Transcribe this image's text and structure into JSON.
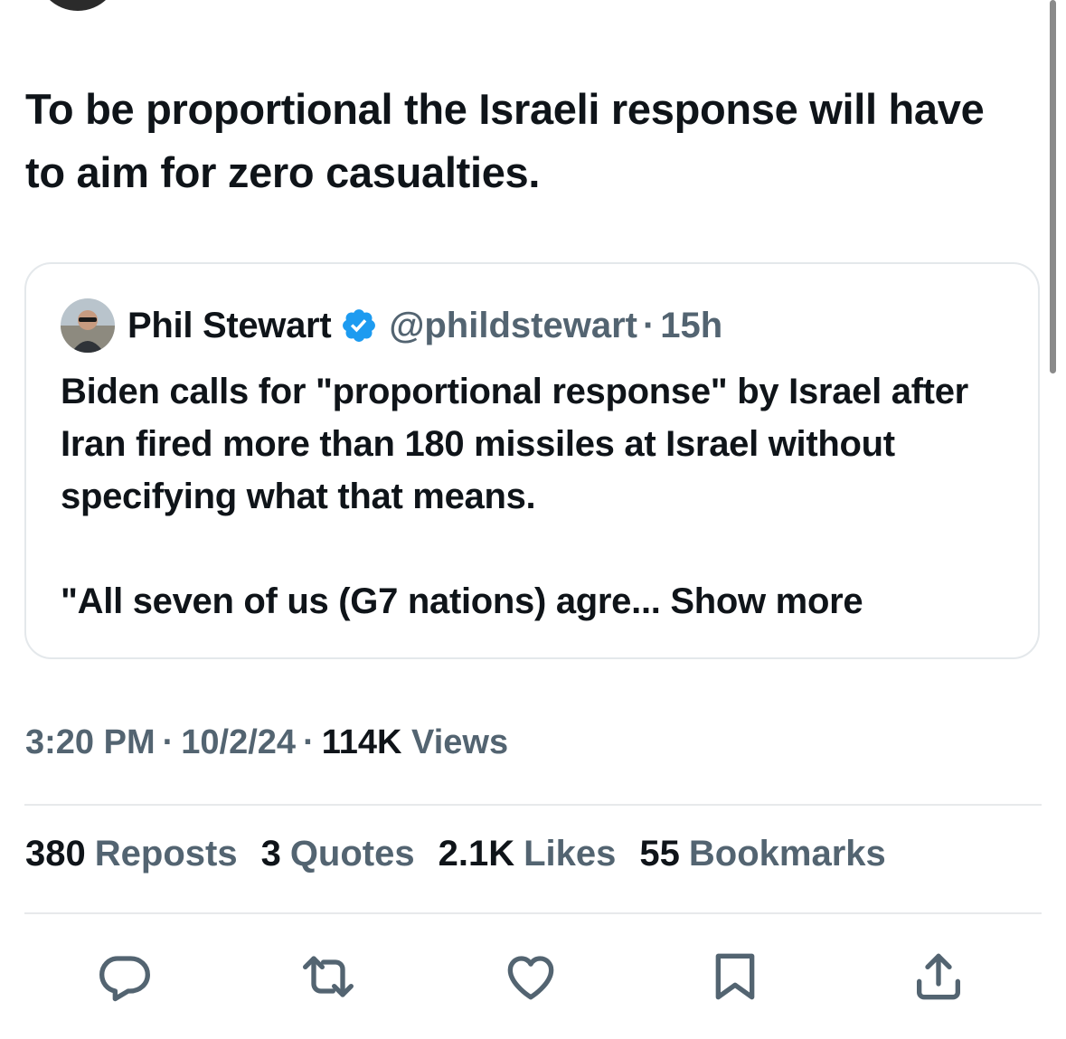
{
  "tweet": {
    "text": "To be proportional the Israeli response will have to aim for zero casualties."
  },
  "quote": {
    "name": "Phil Stewart",
    "handle": "@phildstewart",
    "separator": "·",
    "time": "15h",
    "body_para1": "Biden calls for \"proportional response\" by Israel after Iran fired more than 180 missiles at Israel without specifying what that means.",
    "body_para2": "\"All seven of us (G7 nations) agre...",
    "show_more": "Show more"
  },
  "meta": {
    "time": "3:20 PM",
    "separator": "·",
    "date": "10/2/24",
    "views_count": "114K",
    "views_label": "Views"
  },
  "stats": [
    {
      "count": "380",
      "label": "Reposts"
    },
    {
      "count": "3",
      "label": "Quotes"
    },
    {
      "count": "2.1K",
      "label": "Likes"
    },
    {
      "count": "55",
      "label": "Bookmarks"
    }
  ],
  "icons": {
    "reply": "reply-icon",
    "repost": "repost-icon",
    "like": "heart-icon",
    "bookmark": "bookmark-icon",
    "share": "share-icon",
    "verified": "verified-badge-icon"
  },
  "colors": {
    "text_primary": "#0f1419",
    "text_secondary": "#536471",
    "verified_blue": "#1d9bf0",
    "border": "#e4e8eb"
  }
}
